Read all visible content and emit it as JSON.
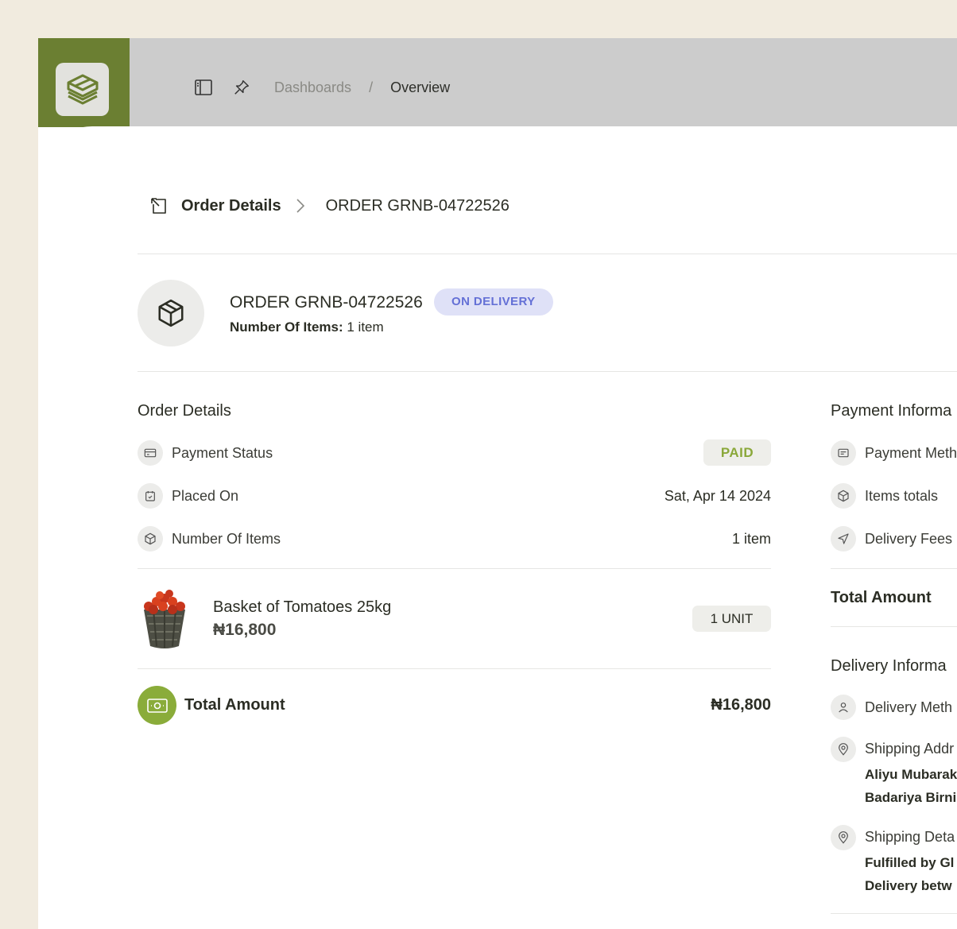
{
  "topbar": {
    "breadcrumb_root": "Dashboards",
    "breadcrumb_sep": "/",
    "breadcrumb_current": "Overview"
  },
  "header": {
    "title": "Order Details",
    "order_ref": "ORDER GRNB-04722526"
  },
  "order": {
    "title": "ORDER GRNB-04722526",
    "status": "ON DELIVERY",
    "items_label": "Number Of Items:",
    "items_value": "1 item"
  },
  "order_details": {
    "title": "Order Details",
    "rows": [
      {
        "label": "Payment Status",
        "value": "PAID"
      },
      {
        "label": "Placed On",
        "value": "Sat, Apr 14 2024"
      },
      {
        "label": "Number Of Items",
        "value": "1 item"
      }
    ]
  },
  "product": {
    "name": "Basket of Tomatoes 25kg",
    "price": "₦16,800",
    "quantity": "1 UNIT"
  },
  "total": {
    "label": "Total Amount",
    "value": "₦16,800"
  },
  "payment_info": {
    "title": "Payment Informa",
    "rows": [
      {
        "label": "Payment Meth"
      },
      {
        "label": "Items totals"
      },
      {
        "label": "Delivery Fees"
      }
    ],
    "total_label": "Total Amount"
  },
  "delivery_info": {
    "title": "Delivery Informa",
    "method_label": "Delivery Meth",
    "shipping_address_label": "Shipping Addr",
    "address_line1": "Aliyu Mubarak",
    "address_line2": "Badariya Birni",
    "shipping_details_label": "Shipping Deta",
    "details_line1": "Fulfilled by Gl",
    "details_line2": "Delivery betw"
  },
  "colors": {
    "brand_green": "#6b7f32",
    "accent_green": "#8aac3a",
    "delivery_badge_bg": "#dfe1f7",
    "delivery_badge_text": "#6470d6"
  }
}
